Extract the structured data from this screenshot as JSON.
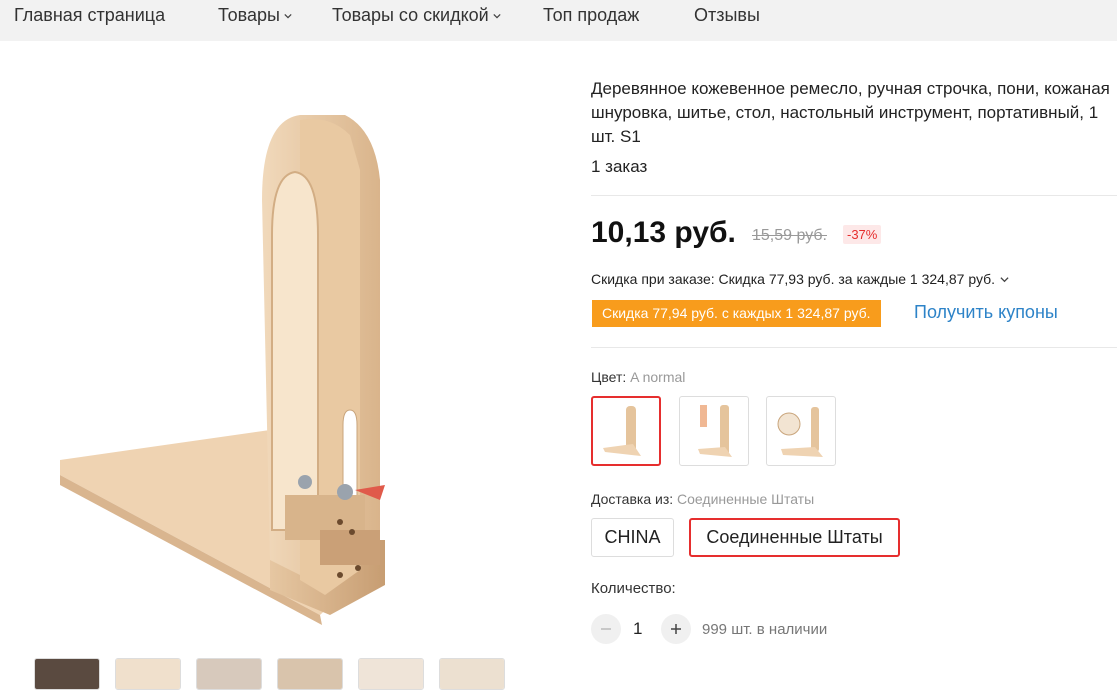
{
  "nav": {
    "items": [
      "Главная страница",
      "Товары",
      "Товары со скидкой",
      "Топ продаж",
      "Отзывы"
    ]
  },
  "product": {
    "title": "Деревянное кожевенное ремесло, ручная строчка, пони, кожаная шнуровка, шитье, стол, настольный инструмент, портативный, 1 шт. S1",
    "orders": "1 заказ",
    "price": "10,13 руб.",
    "old_price": "15,59 руб.",
    "discount_percent": "-37%",
    "order_discount": "Скидка при заказе: Скидка 77,93 руб. за каждые 1 324,87 руб.",
    "coupon_tag": "Скидка 77,94 руб. с каждых 1 324,87 руб.",
    "coupon_link": "Получить купоны"
  },
  "color": {
    "label": "Цвет:",
    "value": "A normal",
    "options": [
      "wooden-holder-swatch",
      "wooden-parts-swatch",
      "wooden-assembled-swatch"
    ],
    "selected": 0
  },
  "shipping": {
    "label": "Доставка из:",
    "value": "Соединенные Штаты",
    "options": [
      "CHINA",
      "Соединенные Штаты"
    ],
    "selected": 1
  },
  "quantity": {
    "label": "Количество:",
    "value": "1",
    "stock": "999 шт. в наличии"
  },
  "colors": {
    "accent_red": "#e62e2e",
    "coupon_orange": "#f89c1c",
    "link_blue": "#2d83c8",
    "wood": "#e8c9a3"
  }
}
